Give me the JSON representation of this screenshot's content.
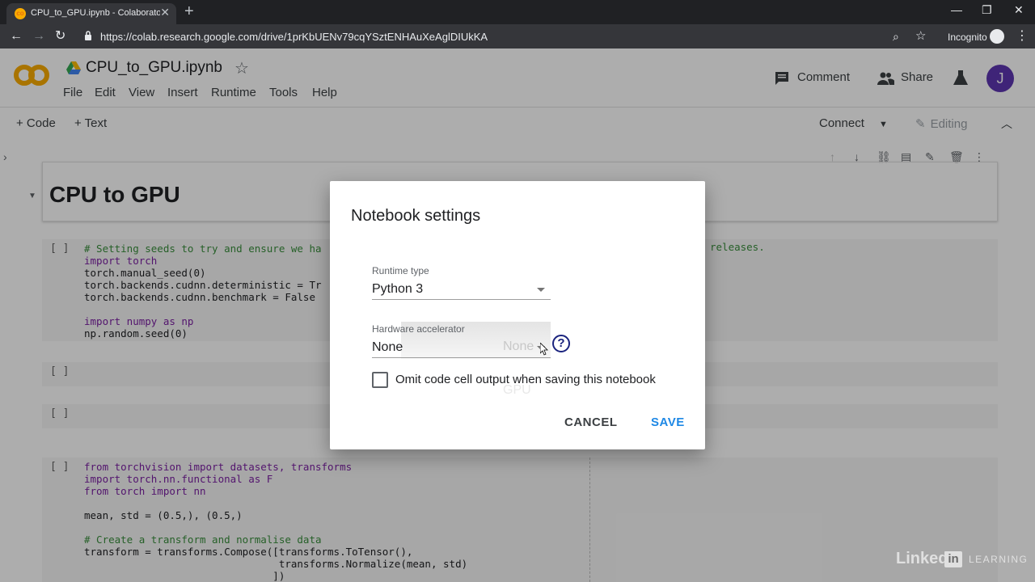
{
  "browser": {
    "tab_title": "CPU_to_GPU.ipynb - Colaborator",
    "new_tab_symbol": "+",
    "url": "https://colab.research.google.com/drive/1prKbUENv79cqYSztENHAuXeAglDIUkKA",
    "incognito_label": "Incognito"
  },
  "colab": {
    "logo_text": "CO",
    "notebook_title": "CPU_to_GPU.ipynb",
    "menu": [
      "File",
      "Edit",
      "View",
      "Insert",
      "Runtime",
      "Tools",
      "Help"
    ],
    "comment_label": "Comment",
    "share_label": "Share",
    "avatar_letter": "J",
    "add_code_label": "+ Code",
    "add_text_label": "+ Text",
    "connect_label": "Connect",
    "editing_label": "Editing"
  },
  "notebook": {
    "heading": "CPU to GPU",
    "run_mark": "[ ]",
    "right_fragment": "releases.",
    "cell1": [
      "# Setting seeds to try and ensure we ha",
      "import torch",
      "torch.manual_seed(0)",
      "torch.backends.cudnn.deterministic = Tr",
      "torch.backends.cudnn.benchmark = False",
      "",
      "import numpy as np",
      "np.random.seed(0)"
    ],
    "cell4": [
      "from torchvision import datasets, transforms",
      "import torch.nn.functional as F",
      "from torch import nn",
      "",
      "mean, std = (0.5,), (0.5,)",
      "",
      "# Create a transform and normalise data",
      "transform = transforms.Compose([transforms.ToTensor(),",
      "                                transforms.Normalize(mean, std)",
      "                               ])"
    ]
  },
  "dialog": {
    "title": "Notebook settings",
    "runtime_type_label": "Runtime type",
    "runtime_type_value": "Python 3",
    "hw_accel_label": "Hardware accelerator",
    "hw_accel_value": "None",
    "hw_ghost_option_none": "None",
    "hw_ghost_option_gpu": "GPU",
    "help_symbol": "?",
    "omit_label": "Omit code cell output when saving this notebook",
    "omit_checked": false,
    "cancel_label": "CANCEL",
    "save_label": "SAVE"
  },
  "watermark": {
    "linked": "Linked",
    "in": "in",
    "learning": "LEARNING"
  },
  "colors": {
    "accent_blue": "#1e88e5",
    "avatar_purple": "#5e35b1",
    "keyword_purple": "#7b1fa2",
    "comment_green": "#388e3c"
  }
}
